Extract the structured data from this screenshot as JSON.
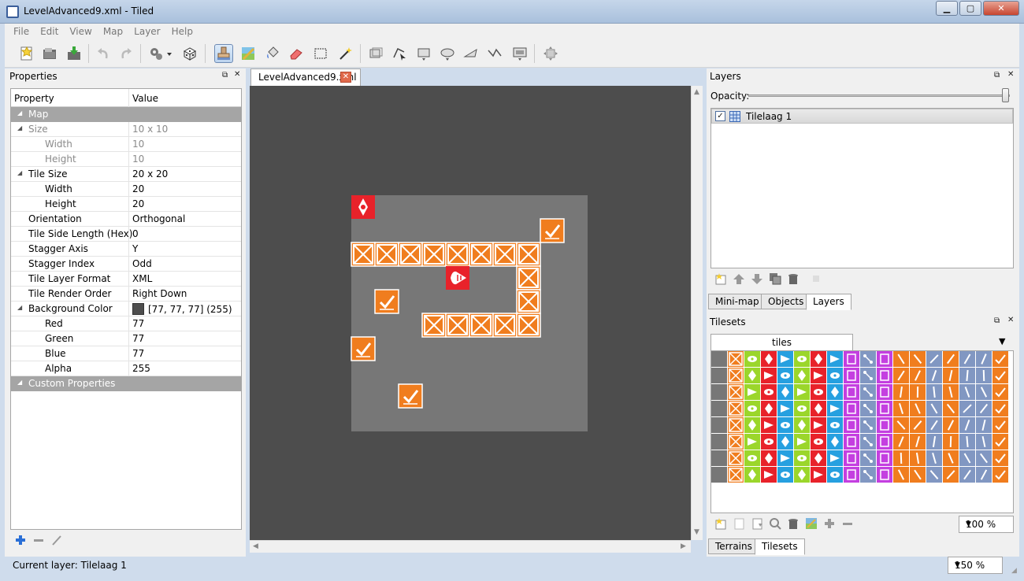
{
  "window": {
    "title": "LevelAdvanced9.xml - Tiled"
  },
  "menu": [
    "File",
    "Edit",
    "View",
    "Map",
    "Layer",
    "Help"
  ],
  "toolbar": {
    "icons": [
      "new-icon",
      "open-icon",
      "save-icon",
      "undo-icon",
      "redo-icon",
      "commands-icon",
      "random-icon",
      "stamp-brush-icon",
      "terrain-brush-icon",
      "bucket-fill-icon",
      "eraser-icon",
      "rect-select-icon",
      "magic-wand-icon",
      "select-objects-icon",
      "edit-polygons-icon",
      "insert-rectangle-icon",
      "insert-ellipse-icon",
      "insert-polygon-icon",
      "insert-polyline-icon",
      "insert-tile-icon",
      "move-icon"
    ]
  },
  "properties": {
    "title": "Properties",
    "col_property": "Property",
    "col_value": "Value",
    "rows": [
      {
        "name": "Map",
        "value": "",
        "kind": "group",
        "arrow": "◢"
      },
      {
        "name": "Size",
        "value": "10 x 10",
        "kind": "dim",
        "indent": 1,
        "arrow": "◢"
      },
      {
        "name": "Width",
        "value": "10",
        "kind": "dim",
        "indent": 2
      },
      {
        "name": "Height",
        "value": "10",
        "kind": "dim",
        "indent": 2
      },
      {
        "name": "Tile Size",
        "value": "20 x 20",
        "kind": "normal",
        "indent": 1,
        "arrow": "◢"
      },
      {
        "name": "Width",
        "value": "20",
        "kind": "normal",
        "indent": 2
      },
      {
        "name": "Height",
        "value": "20",
        "kind": "normal",
        "indent": 2
      },
      {
        "name": "Orientation",
        "value": "Orthogonal",
        "kind": "normal",
        "indent": 1
      },
      {
        "name": "Tile Side Length (Hex)",
        "value": "0",
        "kind": "normal",
        "indent": 1
      },
      {
        "name": "Stagger Axis",
        "value": "Y",
        "kind": "normal",
        "indent": 1
      },
      {
        "name": "Stagger Index",
        "value": "Odd",
        "kind": "normal",
        "indent": 1
      },
      {
        "name": "Tile Layer Format",
        "value": "XML",
        "kind": "normal",
        "indent": 1
      },
      {
        "name": "Tile Render Order",
        "value": "Right Down",
        "kind": "normal",
        "indent": 1
      },
      {
        "name": "Background Color",
        "value": "[77, 77, 77] (255)",
        "kind": "color",
        "indent": 1,
        "arrow": "◢"
      },
      {
        "name": "Red",
        "value": "77",
        "kind": "normal",
        "indent": 2
      },
      {
        "name": "Green",
        "value": "77",
        "kind": "normal",
        "indent": 2
      },
      {
        "name": "Blue",
        "value": "77",
        "kind": "normal",
        "indent": 2
      },
      {
        "name": "Alpha",
        "value": "255",
        "kind": "normal",
        "indent": 2
      },
      {
        "name": "Custom Properties",
        "value": "",
        "kind": "group",
        "arrow": "◢"
      }
    ]
  },
  "status": {
    "current_layer": "Current layer: Tilelaag 1",
    "zoom": "150 %"
  },
  "document_tab": {
    "label": "LevelAdvanced9.xml"
  },
  "map": {
    "bg_color": "#4d4d4d",
    "map_color": "#777777",
    "tile_orange": "#f07d1e",
    "tile_red": "#e8222a",
    "tiles": [
      {
        "c": 0,
        "r": 0,
        "t": "red-diamond"
      },
      {
        "c": 8,
        "r": 1,
        "t": "check"
      },
      {
        "c": 0,
        "r": 2,
        "t": "crate"
      },
      {
        "c": 1,
        "r": 2,
        "t": "crate"
      },
      {
        "c": 2,
        "r": 2,
        "t": "crate"
      },
      {
        "c": 3,
        "r": 2,
        "t": "crate"
      },
      {
        "c": 4,
        "r": 2,
        "t": "crate"
      },
      {
        "c": 5,
        "r": 2,
        "t": "crate"
      },
      {
        "c": 6,
        "r": 2,
        "t": "crate"
      },
      {
        "c": 7,
        "r": 2,
        "t": "crate"
      },
      {
        "c": 7,
        "r": 3,
        "t": "crate"
      },
      {
        "c": 4,
        "r": 3,
        "t": "red-cone"
      },
      {
        "c": 1,
        "r": 4,
        "t": "check"
      },
      {
        "c": 7,
        "r": 4,
        "t": "crate"
      },
      {
        "c": 3,
        "r": 5,
        "t": "crate"
      },
      {
        "c": 4,
        "r": 5,
        "t": "crate"
      },
      {
        "c": 5,
        "r": 5,
        "t": "crate"
      },
      {
        "c": 6,
        "r": 5,
        "t": "crate"
      },
      {
        "c": 7,
        "r": 5,
        "t": "crate"
      },
      {
        "c": 0,
        "r": 6,
        "t": "check"
      },
      {
        "c": 2,
        "r": 8,
        "t": "check"
      }
    ]
  },
  "layers": {
    "title": "Layers",
    "opacity_label": "Opacity:",
    "opacity": 1.0,
    "items": [
      {
        "name": "Tilelaag 1",
        "visible": true
      }
    ],
    "tabs": [
      "Mini-map",
      "Objects",
      "Layers"
    ],
    "selected_tab": "Layers"
  },
  "tilesets": {
    "title": "Tilesets",
    "tab": "tiles",
    "zoom": "100 %",
    "tabs": [
      "Terrains",
      "Tilesets"
    ],
    "selected_tab": "Tilesets",
    "column_colors": [
      "#777777",
      "#f07d1e",
      "#9bd62b",
      "#e8222a",
      "#26a0e0",
      "#9bd62b",
      "#e8222a",
      "#26a0e0",
      "#c43fe0",
      "#8197c2",
      "#c43fe0",
      "#f07d1e",
      "#f07d1e",
      "#8197c2",
      "#f07d1e",
      "#8197c2",
      "#8197c2",
      "#f07d1e"
    ],
    "rows": 8
  }
}
